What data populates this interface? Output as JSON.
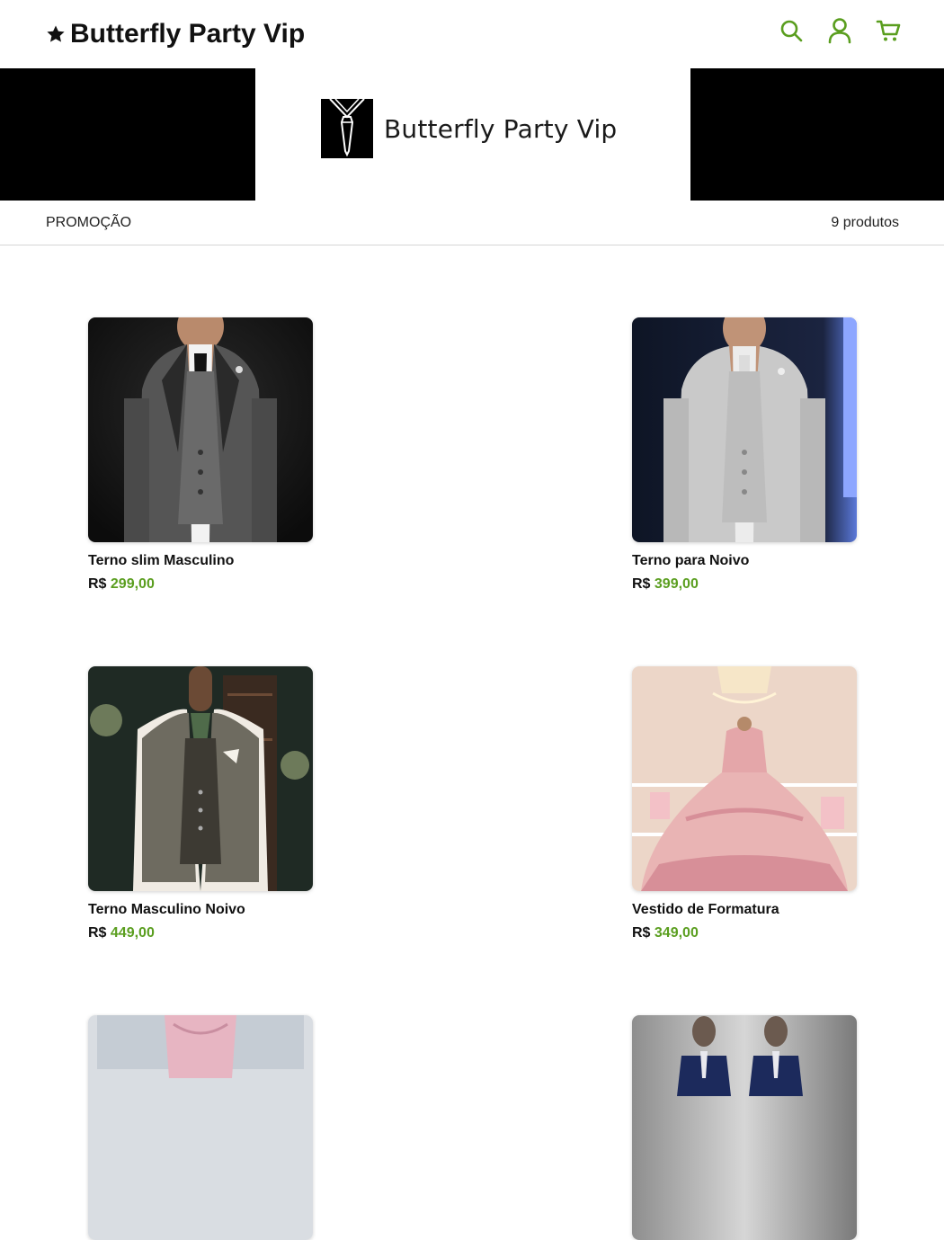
{
  "header": {
    "brand_name": "Butterfly Party Vip",
    "icons": [
      "search-icon",
      "user-icon",
      "cart-icon"
    ],
    "accent_color": "#5a9e1f"
  },
  "banner": {
    "logo_text": "Butterfly Party Vip"
  },
  "subbar": {
    "category": "PROMOÇÃO",
    "product_count": "9 produtos"
  },
  "products": [
    {
      "name": "Terno slim Masculino",
      "currency": "R$",
      "price": "299,00"
    },
    {
      "name": "Terno para Noivo",
      "currency": "R$",
      "price": "399,00"
    },
    {
      "name": "Terno Masculino Noivo",
      "currency": "R$",
      "price": "449,00"
    },
    {
      "name": "Vestido de Formatura",
      "currency": "R$",
      "price": "349,00"
    }
  ]
}
